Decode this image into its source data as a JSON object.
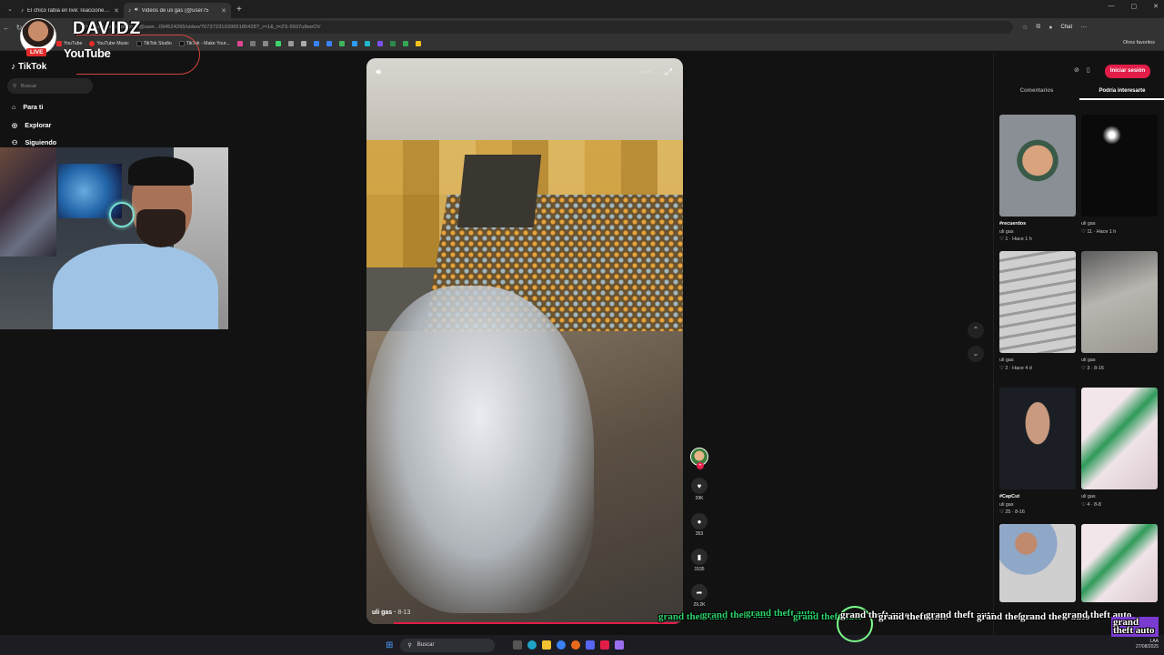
{
  "browser": {
    "tabs": [
      {
        "title": "El chico rabia en live: reacciones y",
        "active": false
      },
      {
        "title": "Videos de uli gas (@user75",
        "active": true
      }
    ],
    "url": "https://www.tiktok.com/@user...094524265/video/7673723193995185428?_r=1&_t=ZS-9937u8eeOV",
    "chat_label": "Chat",
    "bookmarks": [
      "YouTube",
      "YouTube Music",
      "TikTok Studio",
      "TikTok - Make Your..."
    ],
    "other_favorites": "Otros favoritos"
  },
  "stream": {
    "channel": "DAVIDZ",
    "live": "LIVE",
    "platform": "YouTube"
  },
  "tiktok": {
    "logo": "TikTok",
    "search_placeholder": "Buscar",
    "nav": [
      "Para ti",
      "Explorar",
      "Siguiendo"
    ],
    "login": "Iniciar sesión",
    "tabs": [
      "Comentarios",
      "Podría interesarte"
    ],
    "video": {
      "author": "uli gas",
      "date": "8-13",
      "counts": {
        "likes": "39K",
        "comments": "353",
        "saves": "1535",
        "shares": "29.2K"
      }
    },
    "suggestions": [
      {
        "caption": "#recuerdos",
        "author": "uli gas",
        "stats": "1 · Hace 1 h"
      },
      {
        "caption": "",
        "author": "uli gas",
        "stats": "11 · Hace 1 h"
      },
      {
        "caption": "",
        "author": "uli gas",
        "stats": "2 · Hace 4 d"
      },
      {
        "caption": "",
        "author": "uli gas",
        "stats": "3 · 8-16"
      },
      {
        "caption": "#CapCut",
        "author": "uli gas",
        "stats": "25 · 8-16"
      },
      {
        "caption": "",
        "author": "uli gas",
        "stats": "4 · 8-8"
      },
      {
        "caption": "",
        "author": "",
        "stats": ""
      },
      {
        "caption": "",
        "author": "",
        "stats": ""
      }
    ]
  },
  "taskbar": {
    "search_placeholder": "Buscar",
    "lang": "LAA",
    "date": "27/08/2025"
  },
  "overlay": {
    "gta_text": "grand theft auto"
  },
  "colors": {
    "accent": "#e11d48",
    "bg": "#121212"
  }
}
